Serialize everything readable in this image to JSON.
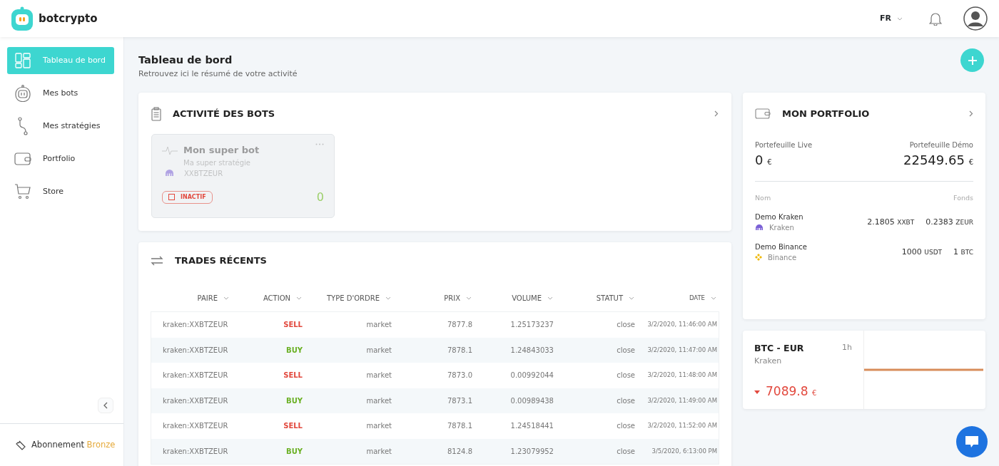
{
  "header": {
    "brand": "botcrypto",
    "language": "FR"
  },
  "sidebar": {
    "items": [
      {
        "label": "Tableau de bord",
        "kind": "dashboard",
        "selected": true
      },
      {
        "label": "Mes bots",
        "kind": "bot",
        "selected": false
      },
      {
        "label": "Mes stratégies",
        "kind": "strategy",
        "selected": false
      },
      {
        "label": "Portfolio",
        "kind": "wallet",
        "selected": false
      },
      {
        "label": "Store",
        "kind": "cart",
        "selected": false
      }
    ],
    "subscription": {
      "label": "Abonnement",
      "plan": "Bronze"
    }
  },
  "page": {
    "title": "Tableau de bord",
    "subtitle": "Retrouvez ici le résumé de votre activité"
  },
  "bot_activity": {
    "title": "ACTIVITÉ DES BOTS",
    "bots": [
      {
        "name": "Mon super bot",
        "strategy": "Ma super stratégie",
        "pair": "XXBTZEUR",
        "status": "INACTIF",
        "active": false,
        "count": "0"
      }
    ]
  },
  "recent_trades": {
    "title": "TRADES RÉCENTS",
    "columns": [
      "PAIRE",
      "ACTION",
      "TYPE D'ORDRE",
      "PRIX",
      "VOLUME",
      "STATUT",
      "DATE"
    ],
    "rows": [
      {
        "pair": "kraken:XXBTZEUR",
        "action": "SELL",
        "kind": "sell",
        "order_type": "market",
        "price": "7877.8",
        "volume": "1.25173237",
        "status": "close",
        "date": "3/2/2020, 11:46:00 AM"
      },
      {
        "pair": "kraken:XXBTZEUR",
        "action": "BUY",
        "kind": "buy",
        "order_type": "market",
        "price": "7878.1",
        "volume": "1.24843033",
        "status": "close",
        "date": "3/2/2020, 11:47:00 AM"
      },
      {
        "pair": "kraken:XXBTZEUR",
        "action": "SELL",
        "kind": "sell",
        "order_type": "market",
        "price": "7873.0",
        "volume": "0.00992044",
        "status": "close",
        "date": "3/2/2020, 11:48:00 AM"
      },
      {
        "pair": "kraken:XXBTZEUR",
        "action": "BUY",
        "kind": "buy",
        "order_type": "market",
        "price": "7873.1",
        "volume": "0.00989438",
        "status": "close",
        "date": "3/2/2020, 11:49:00 AM"
      },
      {
        "pair": "kraken:XXBTZEUR",
        "action": "SELL",
        "kind": "sell",
        "order_type": "market",
        "price": "7878.1",
        "volume": "1.24518441",
        "status": "close",
        "date": "3/2/2020, 11:52:00 AM"
      },
      {
        "pair": "kraken:XXBTZEUR",
        "action": "BUY",
        "kind": "buy",
        "order_type": "market",
        "price": "8124.8",
        "volume": "1.23079952",
        "status": "close",
        "date": "3/5/2020, 6:13:00 PM"
      }
    ]
  },
  "portfolio": {
    "title": "MON PORTFOLIO",
    "live_label": "Portefeuille Live",
    "live_value": "0",
    "live_currency": "€",
    "demo_label": "Portefeuille Démo",
    "demo_value": "22549.65",
    "demo_currency": "€",
    "name_header": "Nom",
    "funds_header": "Fonds",
    "accounts": [
      {
        "name": "Demo Kraken",
        "exchange": "Kraken",
        "kind": "kraken",
        "funds": [
          {
            "amount": "2.1805",
            "unit": "XXBT"
          },
          {
            "amount": "0.2383",
            "unit": "ZEUR"
          }
        ]
      },
      {
        "name": "Demo Binance",
        "exchange": "Binance",
        "kind": "binance",
        "funds": [
          {
            "amount": "1000",
            "unit": "USDT"
          },
          {
            "amount": "1",
            "unit": "BTC"
          }
        ]
      }
    ]
  },
  "ticker": {
    "pair": "BTC - EUR",
    "interval": "1h",
    "exchange": "Kraken",
    "price": "7089.8",
    "currency": "€",
    "kind": "down"
  }
}
